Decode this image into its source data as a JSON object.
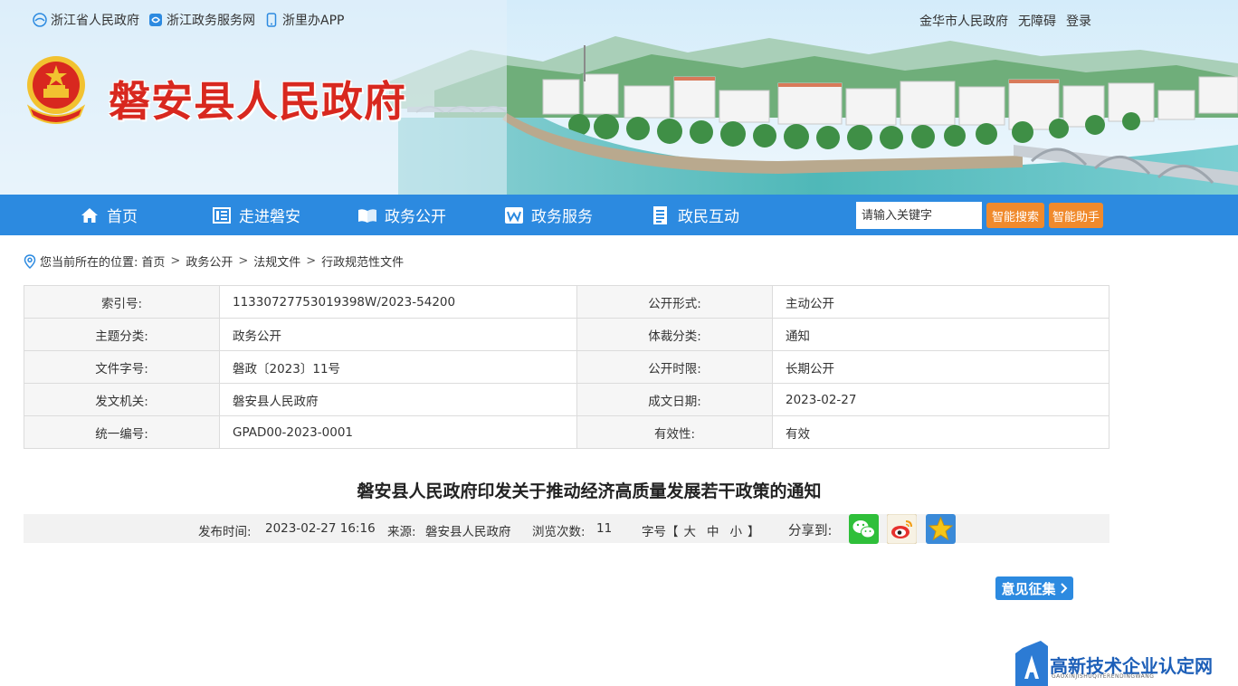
{
  "top_links": [
    {
      "label": "浙江省人民政府",
      "icon": "zhejiang-gov-icon"
    },
    {
      "label": "浙江政务服务网",
      "icon": "service-net-icon"
    },
    {
      "label": "浙里办APP",
      "icon": "mobile-app-icon"
    }
  ],
  "top_right": {
    "city_gov": "金华市人民政府",
    "accessibility": "无障碍",
    "login": "登录"
  },
  "site_title": "磐安县人民政府",
  "nav": {
    "items": [
      {
        "label": "首页",
        "icon": "home-icon"
      },
      {
        "label": "走进磐安",
        "icon": "list-icon"
      },
      {
        "label": "政务公开",
        "icon": "book-icon"
      },
      {
        "label": "政务服务",
        "icon": "w-icon"
      },
      {
        "label": "政民互动",
        "icon": "document-icon"
      }
    ],
    "search_placeholder": "请输入关键字",
    "smart_search": "智能搜索",
    "smart_assistant": "智能助手"
  },
  "breadcrumb": {
    "prefix": "您当前所在的位置:",
    "items": [
      "首页",
      "政务公开",
      "法规文件",
      "行政规范性文件"
    ],
    "sep": ">"
  },
  "info": {
    "rows": [
      {
        "l1": "索引号:",
        "v1": "11330727753019398W/2023-54200",
        "l2": "公开形式:",
        "v2": "主动公开"
      },
      {
        "l1": "主题分类:",
        "v1": "政务公开",
        "l2": "体裁分类:",
        "v2": "通知"
      },
      {
        "l1": "文件字号:",
        "v1": "磐政〔2023〕11号",
        "l2": "公开时限:",
        "v2": "长期公开"
      },
      {
        "l1": "发文机关:",
        "v1": "磐安县人民政府",
        "l2": "成文日期:",
        "v2": "2023-02-27"
      },
      {
        "l1": "统一编号:",
        "v1": "GPAD00-2023-0001",
        "l2": "有效性:",
        "v2": "有效"
      }
    ]
  },
  "article": {
    "title": "磐安县人民政府印发关于推动经济高质量发展若干政策的通知",
    "publish_label": "发布时间:",
    "publish_time": "2023-02-27 16:16",
    "source_label": "来源:",
    "source": "磐安县人民政府",
    "views_label": "浏览次数:",
    "views": "11",
    "fontsize_label": "字号【",
    "fontsize_end": "】",
    "fontsize_options": [
      "大",
      "中",
      "小"
    ],
    "share_label": "分享到:"
  },
  "feedback": {
    "label": "意见征集"
  },
  "watermark": {
    "text": "高新技术企业认定网",
    "sub": "GAOXINJISHUQIYERENDINGWANG"
  },
  "colors": {
    "nav_blue": "#2c8ae0",
    "title_red": "#d8281f",
    "orange": "#f08a2c"
  }
}
